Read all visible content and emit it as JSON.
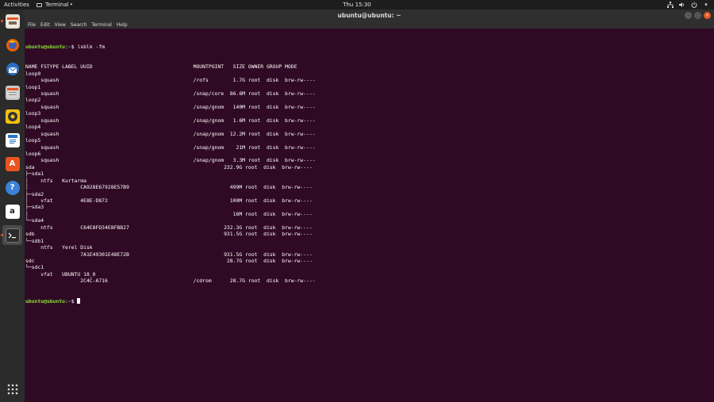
{
  "topbar": {
    "activities": "Activities",
    "app_menu": "Terminal",
    "clock": "Thu 15:30"
  },
  "dock": {
    "items": [
      {
        "name": "files",
        "icon": "files-icon"
      },
      {
        "name": "firefox",
        "icon": "firefox-icon"
      },
      {
        "name": "thunderbird",
        "icon": "thunderbird-icon"
      },
      {
        "name": "file-manager",
        "icon": "file-manager-icon"
      },
      {
        "name": "rhythmbox",
        "icon": "rhythmbox-icon"
      },
      {
        "name": "libreoffice-writer",
        "icon": "writer-icon"
      },
      {
        "name": "ubuntu-software",
        "icon": "software-icon"
      },
      {
        "name": "help",
        "icon": "help-icon"
      },
      {
        "name": "amazon",
        "icon": "amazon-icon"
      },
      {
        "name": "terminal",
        "icon": "terminal-icon"
      }
    ],
    "show_apps_icon": "grid-icon"
  },
  "window": {
    "title": "ubuntu@ubuntu: ~",
    "menu": [
      "File",
      "Edit",
      "View",
      "Search",
      "Terminal",
      "Help"
    ]
  },
  "terminal": {
    "prompt_user": "ubuntu@ubuntu",
    "prompt_sep": ":",
    "prompt_path": "~",
    "prompt_end": "$ ",
    "command": "lsblk -fm",
    "output": [
      "NAME FSTYPE LABEL UUID                                 MOUNTPOINT   SIZE OWNER GROUP MODE",
      "loop0",
      "     squash                                            /rofs        1.7G root  disk  brw-rw----",
      "loop1",
      "     squash                                            /snap/core  86.6M root  disk  brw-rw----",
      "loop2",
      "     squash                                            /snap/gnom   140M root  disk  brw-rw----",
      "loop3",
      "     squash                                            /snap/gnom   1.6M root  disk  brw-rw----",
      "loop4",
      "     squash                                            /snap/gnom  12.2M root  disk  brw-rw----",
      "loop5",
      "     squash                                            /snap/gnom    21M root  disk  brw-rw----",
      "loop6",
      "     squash                                            /snap/gnom   3.3M root  disk  brw-rw----",
      "sda                                                              232.9G root  disk  brw-rw----",
      "├─sda1",
      "│    ntfs   Kurtarma",
      "│                 CA928E67928E57B9                                 499M root  disk  brw-rw----",
      "├─sda2",
      "│    vfat         4E8E-D872                                        100M root  disk  brw-rw----",
      "├─sda3",
      "│                                                                   16M root  disk  brw-rw----",
      "└─sda4",
      "     ntfs         C64E8FD34E8FBB27                               232.3G root  disk  brw-rw----",
      "sdb                                                              931.5G root  disk  brw-rw----",
      "└─sdb1",
      "     ntfs   Yerel Disk",
      "                  7A1E49301E48E72B                               931.5G root  disk  brw-rw----",
      "sdc                                                               28.7G root  disk  brw-rw----",
      "└─sdc1",
      "     vfat   UBUNTU 18_0",
      "                  2C4C-A716                            /cdrom      28.7G root  disk  brw-rw----"
    ]
  },
  "colors": {
    "terminal_bg": "#300a24",
    "prompt_user": "#8ae234",
    "prompt_path": "#729fcf",
    "accent": "#e95420"
  }
}
